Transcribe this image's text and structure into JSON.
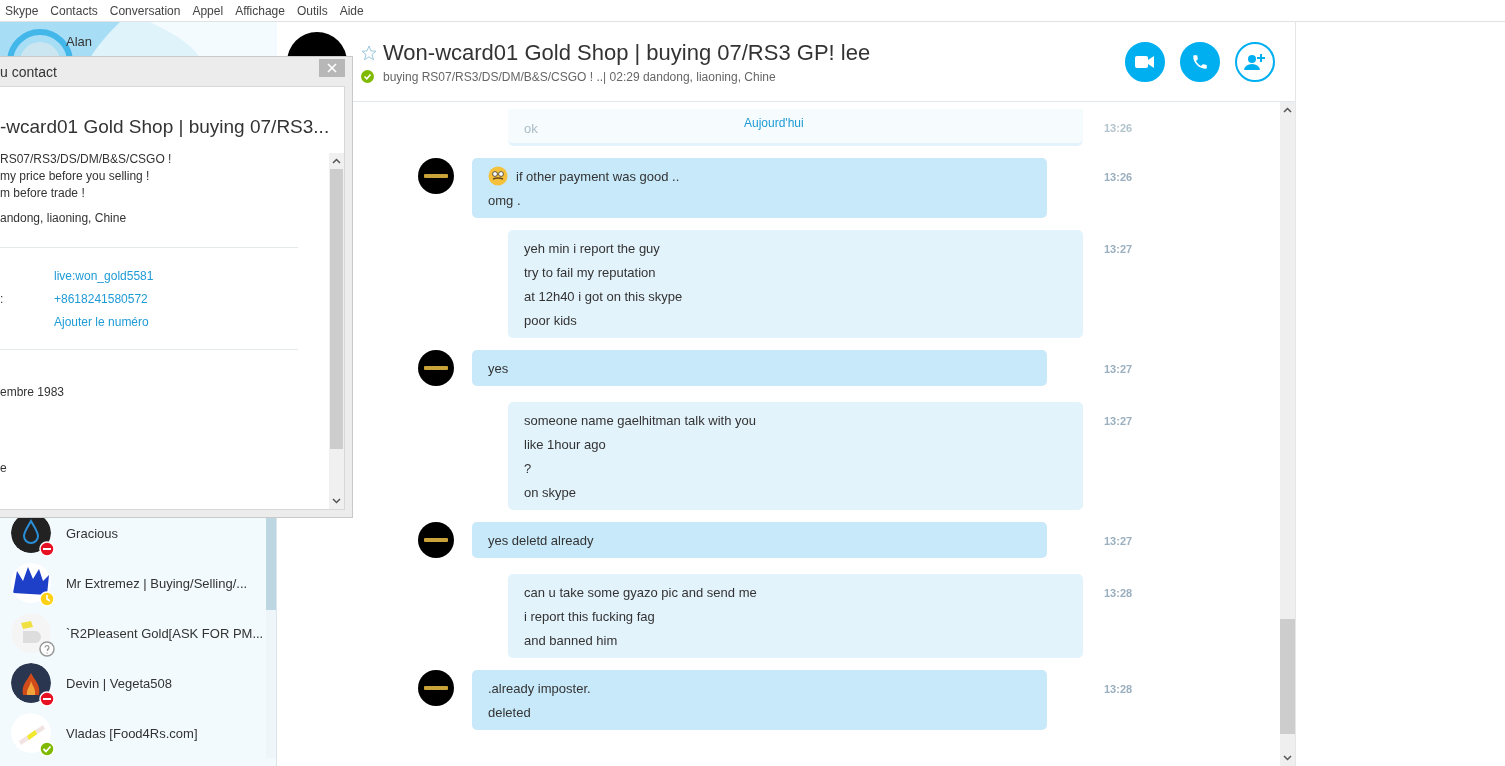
{
  "menu": [
    "Skype",
    "Contacts",
    "Conversation",
    "Appel",
    "Affichage",
    "Outils",
    "Aide"
  ],
  "sidebar": {
    "profile_name": "Alan",
    "contacts": [
      {
        "name": "Gracious",
        "color": "#e81123"
      },
      {
        "name": "Mr Extremez | Buying/Selling/...",
        "color": "#fcd116"
      },
      {
        "name": "`R2Pleasent Gold[ASK FOR PM...",
        "color": "#ffffff"
      },
      {
        "name": "Devin | Vegeta508",
        "color": "#e81123"
      },
      {
        "name": "Vladas [Food4Rs.com]",
        "color": "#7fba00"
      }
    ]
  },
  "dialog": {
    "title": "u contact",
    "heading": "-wcard01 Gold Shop |  buying 07/RS3...",
    "mood_lines": [
      "RS07/RS3/DS/DM/B&S/CSGO !",
      "my price before you selling !",
      "m before trade !"
    ],
    "location": "andong, liaoning, Chine",
    "details": [
      {
        "value": "live:won_gold5581"
      },
      {
        "label": ":",
        "value": "+8618241580572"
      },
      {
        "value": "Ajouter le numéro"
      }
    ],
    "birthday": "embre 1983",
    "extra": "e"
  },
  "conversation": {
    "title": "Won-wcard01 Gold Shop |  buying 07/RS3 GP! lee",
    "favorite": false,
    "online": true,
    "subtitle": "buying RS07/RS3/DS/DM/B&S/CSGO ! ..|  02:29 dandong, liaoning, Chine",
    "date_separator": "Aujourd'hui",
    "faded_message": {
      "text": "ok",
      "time": "13:26"
    },
    "messages": [
      {
        "kind": "incoming",
        "emoticon": true,
        "time": "13:26",
        "lines": [
          "if other payment was good ..",
          "omg ."
        ]
      },
      {
        "kind": "outgoing",
        "emoticon": false,
        "time": "13:27",
        "lines": [
          "yeh min i report the guy",
          "try to fail my reputation",
          "at 12h40 i got on this skype",
          "poor kids"
        ]
      },
      {
        "kind": "incoming",
        "emoticon": false,
        "time": "13:27",
        "lines": [
          "yes"
        ]
      },
      {
        "kind": "outgoing",
        "emoticon": false,
        "time": "13:27",
        "lines": [
          "someone name gaelhitman talk with you",
          "like 1hour ago",
          "?",
          "on skype"
        ]
      },
      {
        "kind": "incoming",
        "emoticon": false,
        "time": "13:27",
        "lines": [
          "yes deletd already"
        ]
      },
      {
        "kind": "outgoing",
        "emoticon": false,
        "time": "13:28",
        "lines": [
          "can u take some gyazo pic and send me",
          "i report this fucking fag",
          "and banned him"
        ]
      },
      {
        "kind": "incoming",
        "emoticon": false,
        "time": "13:28",
        "lines": [
          ".already imposter.",
          "deleted"
        ]
      }
    ]
  }
}
